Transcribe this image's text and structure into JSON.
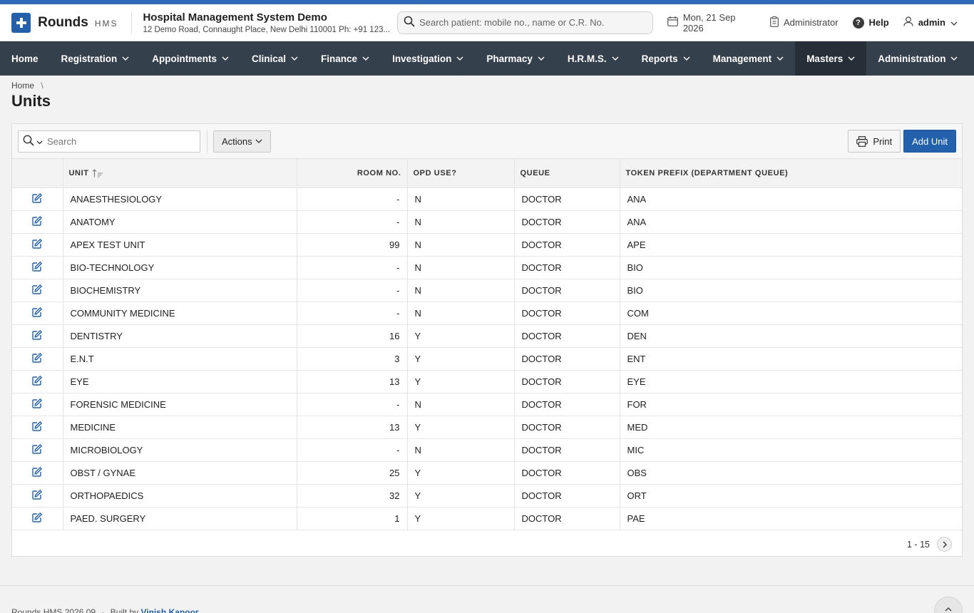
{
  "brand": {
    "name": "Rounds",
    "sub": "HMS"
  },
  "org": {
    "name": "Hospital Management System Demo",
    "address": "12 Demo Road, Connaught Place, New Delhi 110001 Ph: +91 123..."
  },
  "header": {
    "search_placeholder": "Search patient: mobile no., name or C.R. No.",
    "date": "Mon, 21 Sep 2026",
    "role": "Administrator",
    "help": "Help",
    "user": "admin"
  },
  "nav": [
    {
      "label": "Home"
    },
    {
      "label": "Registration"
    },
    {
      "label": "Appointments"
    },
    {
      "label": "Clinical"
    },
    {
      "label": "Finance"
    },
    {
      "label": "Investigation"
    },
    {
      "label": "Pharmacy"
    },
    {
      "label": "H.R.M.S."
    },
    {
      "label": "Reports"
    },
    {
      "label": "Management"
    },
    {
      "label": "Masters"
    },
    {
      "label": "Administration"
    }
  ],
  "breadcrumb": {
    "home": "Home",
    "separator": "\\"
  },
  "page_title": "Units",
  "toolbar": {
    "search_placeholder": "Search",
    "actions_label": "Actions",
    "print_label": "Print",
    "add_label": "Add Unit"
  },
  "table": {
    "columns": [
      "UNIT",
      "ROOM NO.",
      "OPD USE?",
      "QUEUE",
      "TOKEN PREFIX (DEPARTMENT QUEUE)"
    ],
    "rows": [
      {
        "unit": "ANAESTHESIOLOGY",
        "room": "-",
        "opd": "N",
        "queue": "DOCTOR",
        "prefix": "ANA"
      },
      {
        "unit": "ANATOMY",
        "room": "-",
        "opd": "N",
        "queue": "DOCTOR",
        "prefix": "ANA"
      },
      {
        "unit": "APEX TEST UNIT",
        "room": "99",
        "opd": "N",
        "queue": "DOCTOR",
        "prefix": "APE"
      },
      {
        "unit": "BIO-TECHNOLOGY",
        "room": "-",
        "opd": "N",
        "queue": "DOCTOR",
        "prefix": "BIO"
      },
      {
        "unit": "BIOCHEMISTRY",
        "room": "-",
        "opd": "N",
        "queue": "DOCTOR",
        "prefix": "BIO"
      },
      {
        "unit": "COMMUNITY MEDICINE",
        "room": "-",
        "opd": "N",
        "queue": "DOCTOR",
        "prefix": "COM"
      },
      {
        "unit": "DENTISTRY",
        "room": "16",
        "opd": "Y",
        "queue": "DOCTOR",
        "prefix": "DEN"
      },
      {
        "unit": "E.N.T",
        "room": "3",
        "opd": "Y",
        "queue": "DOCTOR",
        "prefix": "ENT"
      },
      {
        "unit": "EYE",
        "room": "13",
        "opd": "Y",
        "queue": "DOCTOR",
        "prefix": "EYE"
      },
      {
        "unit": "FORENSIC MEDICINE",
        "room": "-",
        "opd": "N",
        "queue": "DOCTOR",
        "prefix": "FOR"
      },
      {
        "unit": "MEDICINE",
        "room": "13",
        "opd": "Y",
        "queue": "DOCTOR",
        "prefix": "MED"
      },
      {
        "unit": "MICROBIOLOGY",
        "room": "-",
        "opd": "N",
        "queue": "DOCTOR",
        "prefix": "MIC"
      },
      {
        "unit": "OBST / GYNAE",
        "room": "25",
        "opd": "Y",
        "queue": "DOCTOR",
        "prefix": "OBS"
      },
      {
        "unit": "ORTHOPAEDICS",
        "room": "32",
        "opd": "Y",
        "queue": "DOCTOR",
        "prefix": "ORT"
      },
      {
        "unit": "PAED. SURGERY",
        "room": "1",
        "opd": "Y",
        "queue": "DOCTOR",
        "prefix": "PAE"
      }
    ]
  },
  "pagination": {
    "range": "1 - 15"
  },
  "footer": {
    "version": "Rounds HMS 2026.09",
    "separator": "·",
    "built_by": "Built by",
    "author": "Vinish Kapoor"
  },
  "icons": {
    "logo": "plus-icon",
    "search": "search-icon",
    "calendar": "calendar-icon",
    "role": "clipboard-icon",
    "help": "question-icon",
    "user": "user-icon",
    "edit": "edit-icon",
    "print": "printer-icon",
    "next": "chevron-right-icon",
    "scroll_top": "chevron-up-icon",
    "sort": "sort-ascending-icon"
  },
  "colors": {
    "accent": "#2461ad",
    "topstrip": "#2f6ab7",
    "nav_bg": "#34404b",
    "nav_active": "#262f38"
  }
}
